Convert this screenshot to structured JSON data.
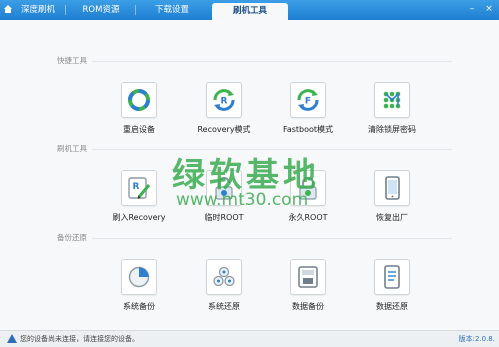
{
  "tabs": [
    {
      "label": "深度刷机",
      "active": false
    },
    {
      "label": "ROM资源",
      "active": false
    },
    {
      "label": "下载设置",
      "active": false
    },
    {
      "label": "刷机工具",
      "active": true
    }
  ],
  "window_controls": {
    "minimize": "–",
    "close": "×"
  },
  "sections": {
    "quick": {
      "title": "快捷工具",
      "tools": [
        {
          "label": "重启设备",
          "icon": "restart-icon"
        },
        {
          "label": "Recovery模式",
          "icon": "recovery-mode-icon"
        },
        {
          "label": "Fastboot模式",
          "icon": "fastboot-mode-icon"
        },
        {
          "label": "清除锁屏密码",
          "icon": "clear-lock-password-icon"
        }
      ]
    },
    "flash": {
      "title": "刷机工具",
      "tools": [
        {
          "label": "刷入Recovery",
          "icon": "flash-recovery-icon"
        },
        {
          "label": "临时ROOT",
          "icon": "temp-root-icon"
        },
        {
          "label": "永久ROOT",
          "icon": "permanent-root-icon"
        },
        {
          "label": "恢复出厂",
          "icon": "factory-reset-icon"
        }
      ]
    },
    "backup": {
      "title": "备份还原",
      "tools": [
        {
          "label": "系统备份",
          "icon": "system-backup-icon"
        },
        {
          "label": "系统还原",
          "icon": "system-restore-icon"
        },
        {
          "label": "数据备份",
          "icon": "data-backup-icon"
        },
        {
          "label": "数据还原",
          "icon": "data-restore-icon"
        }
      ]
    }
  },
  "watermark": {
    "text_cn": "绿软基地",
    "url": "www.mt30.com"
  },
  "status": {
    "message": "您的设备尚未连接，请连接您的设备。",
    "version": "版本:2.0.8."
  },
  "colors": {
    "titlebar": "#2a8ddc",
    "accent_blue": "#2f7fd1",
    "accent_green": "#3db24f",
    "watermark": "#3aaa50"
  }
}
